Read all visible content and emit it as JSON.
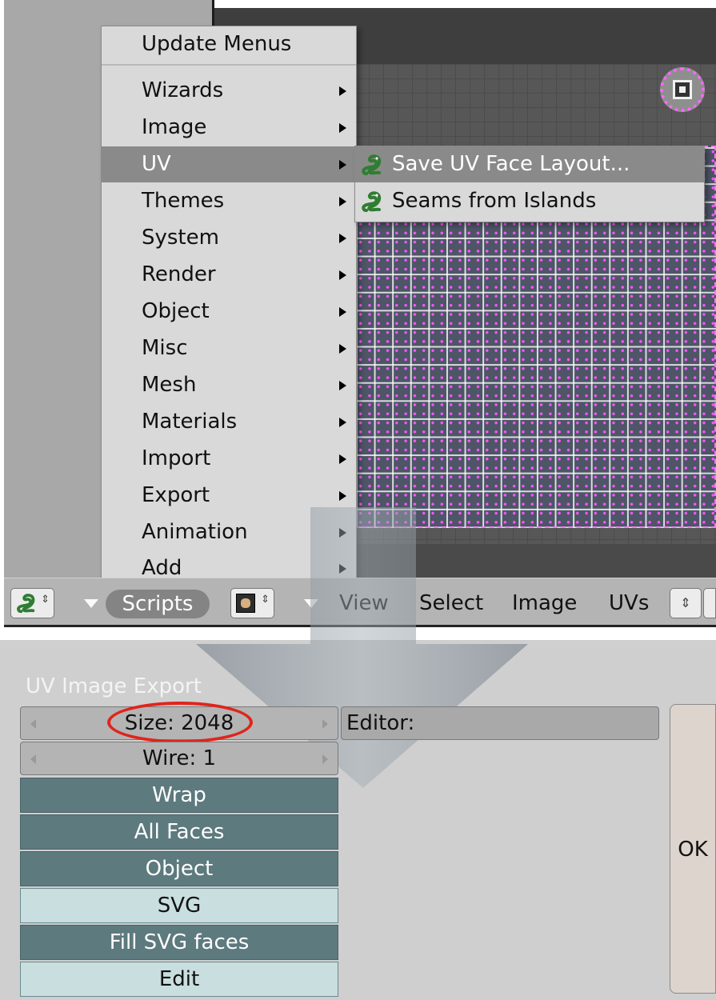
{
  "scripts_menu": {
    "items": [
      {
        "label": "Update Menus",
        "has_submenu": false
      },
      {
        "label": "Wizards",
        "has_submenu": true
      },
      {
        "label": "Image",
        "has_submenu": true
      },
      {
        "label": "UV",
        "has_submenu": true,
        "active": true
      },
      {
        "label": "Themes",
        "has_submenu": true
      },
      {
        "label": "System",
        "has_submenu": true
      },
      {
        "label": "Render",
        "has_submenu": true
      },
      {
        "label": "Object",
        "has_submenu": true
      },
      {
        "label": "Misc",
        "has_submenu": true
      },
      {
        "label": "Mesh",
        "has_submenu": true
      },
      {
        "label": "Materials",
        "has_submenu": true
      },
      {
        "label": "Import",
        "has_submenu": true
      },
      {
        "label": "Export",
        "has_submenu": true
      },
      {
        "label": "Animation",
        "has_submenu": true
      },
      {
        "label": "Add",
        "has_submenu": true
      }
    ]
  },
  "uv_submenu": {
    "items": [
      {
        "label": "Save UV Face Layout...",
        "icon": "python-snake-icon",
        "active": true
      },
      {
        "label": "Seams from Islands",
        "icon": "python-snake-icon"
      }
    ]
  },
  "header": {
    "scripts_label": "Scripts",
    "menus": [
      "View",
      "Select",
      "Image",
      "UVs"
    ],
    "updown_glyph": "⇕"
  },
  "export_panel": {
    "title": "UV Image Export",
    "size_label": "Size: 2048",
    "wire_label": "Wire: 1",
    "editor_label": "Editor:",
    "toggles": [
      {
        "label": "Wrap",
        "state": "on"
      },
      {
        "label": "All Faces",
        "state": "on"
      },
      {
        "label": "Object",
        "state": "on"
      },
      {
        "label": "SVG",
        "state": "off"
      },
      {
        "label": "Fill SVG faces",
        "state": "on"
      },
      {
        "label": "Edit",
        "state": "off"
      }
    ],
    "ok_label": "OK"
  },
  "colors": {
    "highlight_ring": "#e0241b",
    "toggle_on": "#5d7a7e",
    "toggle_off": "#c8dedf",
    "uv_vertex": "#ff55ff"
  }
}
